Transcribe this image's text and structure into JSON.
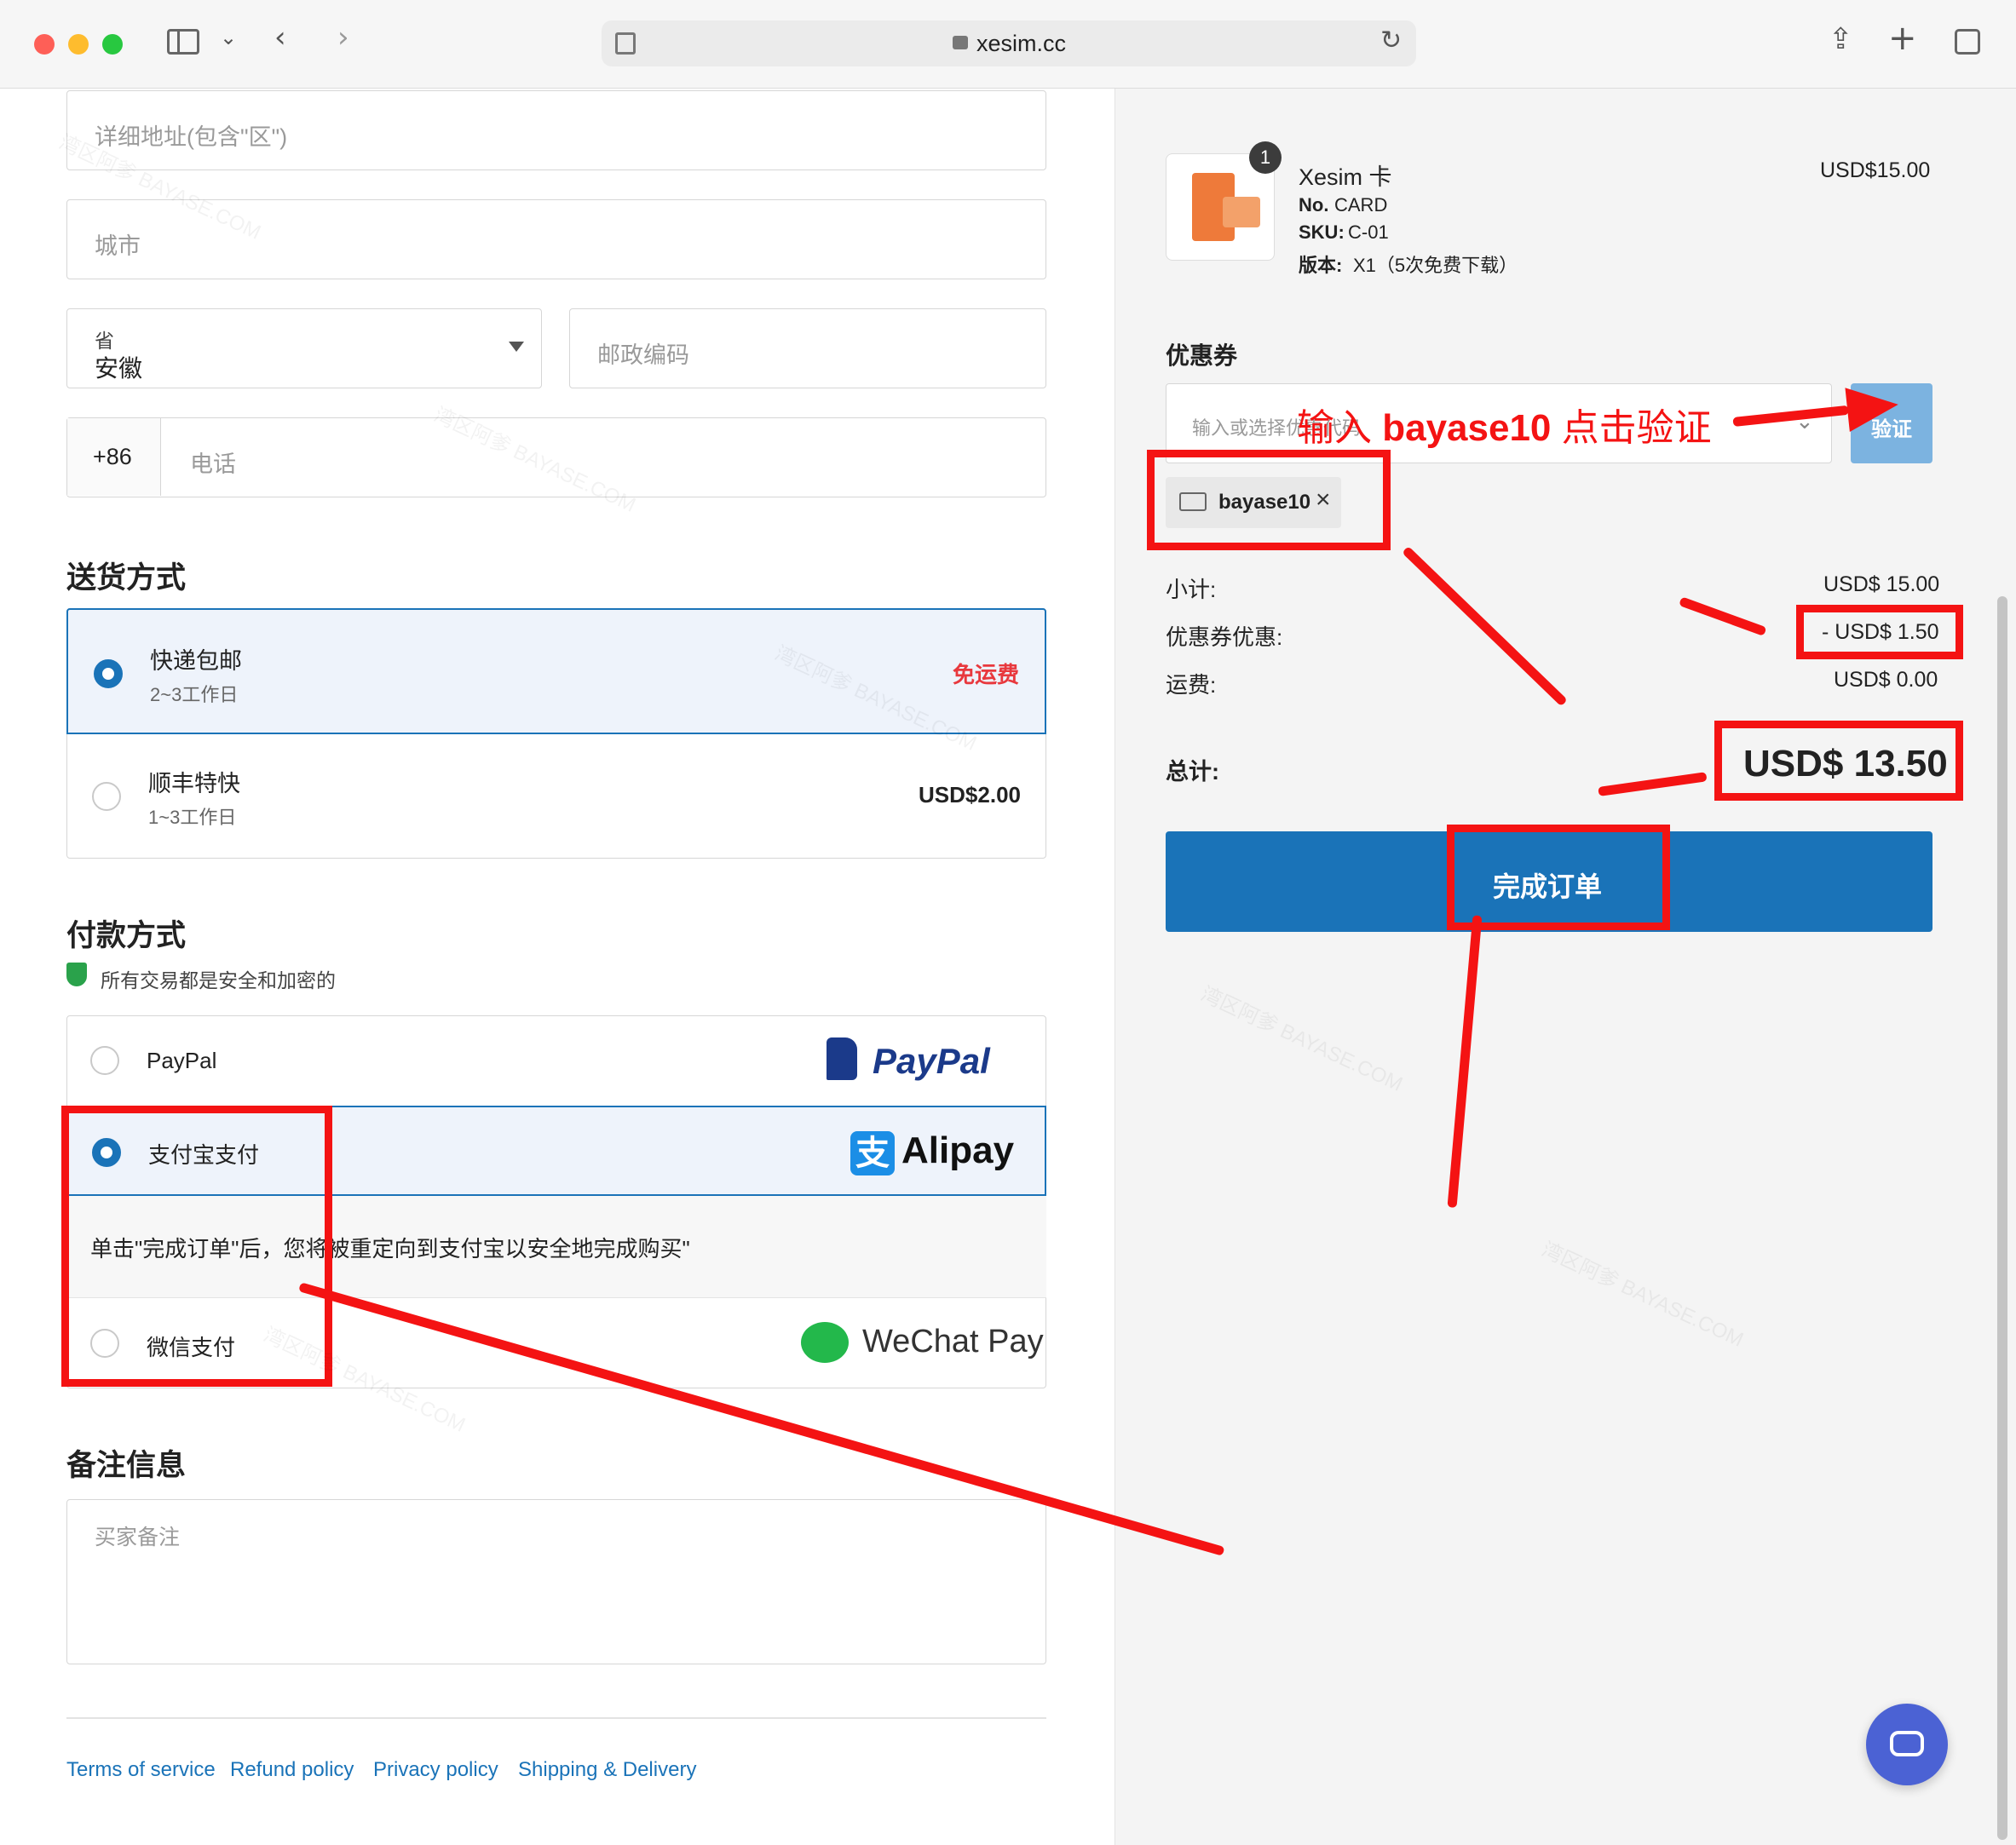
{
  "browser": {
    "url": "xesim.cc"
  },
  "address": {
    "detail_placeholder": "详细地址(包含\"区\")",
    "city_placeholder": "城市",
    "province_label": "省",
    "province_value": "安徽",
    "zip_placeholder": "邮政编码",
    "phone_code": "+86",
    "phone_placeholder": "电话"
  },
  "shipping": {
    "title": "送货方式",
    "options": [
      {
        "name": "快递包邮",
        "eta": "2~3工作日",
        "price": "免运费",
        "selected": true
      },
      {
        "name": "顺丰特快",
        "eta": "1~3工作日",
        "price": "USD$2.00",
        "selected": false
      }
    ]
  },
  "payment": {
    "title": "付款方式",
    "secure_note": "所有交易都是安全和加密的",
    "options": [
      {
        "name": "PayPal",
        "logo": "PayPal",
        "selected": false
      },
      {
        "name": "支付宝支付",
        "logo": "Alipay",
        "selected": true
      },
      {
        "name": "微信支付",
        "logo": "WeChat Pay",
        "selected": false
      }
    ],
    "alipay_note": "单击\"完成订单\"后，您将被重定向到支付宝以安全地完成购买\""
  },
  "notes": {
    "title": "备注信息",
    "placeholder": "买家备注"
  },
  "footer": {
    "links": [
      "Terms of service",
      "Refund policy",
      "Privacy policy",
      "Shipping & Delivery"
    ]
  },
  "order": {
    "item": {
      "qty": "1",
      "name": "Xesim 卡",
      "no_label": "No.",
      "no": "CARD",
      "sku_label": "SKU:",
      "sku": "C-01",
      "version_label": "版本:",
      "version": "X1（5次免费下载）",
      "price": "USD$15.00"
    },
    "coupon": {
      "title": "优惠券",
      "placeholder": "输入或选择优惠代码",
      "verify_label": "验证",
      "applied_code": "bayase10"
    },
    "subtotal_label": "小计:",
    "subtotal": "USD$ 15.00",
    "discount_label": "优惠券优惠:",
    "discount": "- USD$ 1.50",
    "shipping_label": "运费:",
    "shipping": "USD$ 0.00",
    "total_label": "总计:",
    "total": "USD$ 13.50",
    "submit_label": "完成订单"
  },
  "annotation": {
    "instruction_prefix": "输入 ",
    "instruction_code": "bayase10",
    "instruction_suffix": " 点击验证"
  },
  "watermark": "湾区阿爹 BAYASE.COM",
  "colors": {
    "accent": "#1a73b8",
    "annotation": "#f41313",
    "free_shipping": "#e8383d",
    "verify_button": "#7cb3e0"
  }
}
